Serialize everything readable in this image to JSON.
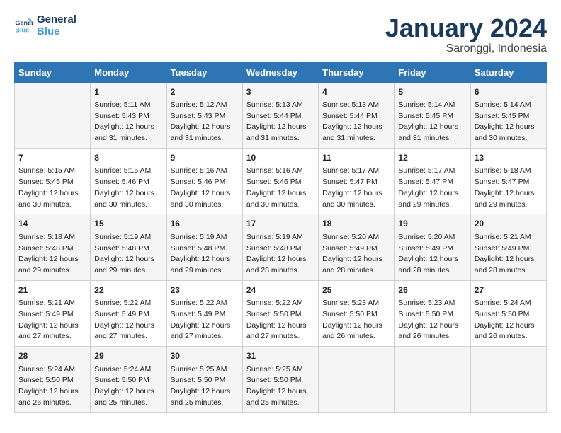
{
  "header": {
    "logo_general": "General",
    "logo_blue": "Blue",
    "title": "January 2024",
    "subtitle": "Saronggi, Indonesia"
  },
  "days_header": [
    "Sunday",
    "Monday",
    "Tuesday",
    "Wednesday",
    "Thursday",
    "Friday",
    "Saturday"
  ],
  "weeks": [
    [
      {
        "day": "",
        "info": ""
      },
      {
        "day": "1",
        "info": "Sunrise: 5:11 AM\nSunset: 5:43 PM\nDaylight: 12 hours\nand 31 minutes."
      },
      {
        "day": "2",
        "info": "Sunrise: 5:12 AM\nSunset: 5:43 PM\nDaylight: 12 hours\nand 31 minutes."
      },
      {
        "day": "3",
        "info": "Sunrise: 5:13 AM\nSunset: 5:44 PM\nDaylight: 12 hours\nand 31 minutes."
      },
      {
        "day": "4",
        "info": "Sunrise: 5:13 AM\nSunset: 5:44 PM\nDaylight: 12 hours\nand 31 minutes."
      },
      {
        "day": "5",
        "info": "Sunrise: 5:14 AM\nSunset: 5:45 PM\nDaylight: 12 hours\nand 31 minutes."
      },
      {
        "day": "6",
        "info": "Sunrise: 5:14 AM\nSunset: 5:45 PM\nDaylight: 12 hours\nand 30 minutes."
      }
    ],
    [
      {
        "day": "7",
        "info": "Sunrise: 5:15 AM\nSunset: 5:45 PM\nDaylight: 12 hours\nand 30 minutes."
      },
      {
        "day": "8",
        "info": "Sunrise: 5:15 AM\nSunset: 5:46 PM\nDaylight: 12 hours\nand 30 minutes."
      },
      {
        "day": "9",
        "info": "Sunrise: 5:16 AM\nSunset: 5:46 PM\nDaylight: 12 hours\nand 30 minutes."
      },
      {
        "day": "10",
        "info": "Sunrise: 5:16 AM\nSunset: 5:46 PM\nDaylight: 12 hours\nand 30 minutes."
      },
      {
        "day": "11",
        "info": "Sunrise: 5:17 AM\nSunset: 5:47 PM\nDaylight: 12 hours\nand 30 minutes."
      },
      {
        "day": "12",
        "info": "Sunrise: 5:17 AM\nSunset: 5:47 PM\nDaylight: 12 hours\nand 29 minutes."
      },
      {
        "day": "13",
        "info": "Sunrise: 5:18 AM\nSunset: 5:47 PM\nDaylight: 12 hours\nand 29 minutes."
      }
    ],
    [
      {
        "day": "14",
        "info": "Sunrise: 5:18 AM\nSunset: 5:48 PM\nDaylight: 12 hours\nand 29 minutes."
      },
      {
        "day": "15",
        "info": "Sunrise: 5:19 AM\nSunset: 5:48 PM\nDaylight: 12 hours\nand 29 minutes."
      },
      {
        "day": "16",
        "info": "Sunrise: 5:19 AM\nSunset: 5:48 PM\nDaylight: 12 hours\nand 29 minutes."
      },
      {
        "day": "17",
        "info": "Sunrise: 5:19 AM\nSunset: 5:48 PM\nDaylight: 12 hours\nand 28 minutes."
      },
      {
        "day": "18",
        "info": "Sunrise: 5:20 AM\nSunset: 5:49 PM\nDaylight: 12 hours\nand 28 minutes."
      },
      {
        "day": "19",
        "info": "Sunrise: 5:20 AM\nSunset: 5:49 PM\nDaylight: 12 hours\nand 28 minutes."
      },
      {
        "day": "20",
        "info": "Sunrise: 5:21 AM\nSunset: 5:49 PM\nDaylight: 12 hours\nand 28 minutes."
      }
    ],
    [
      {
        "day": "21",
        "info": "Sunrise: 5:21 AM\nSunset: 5:49 PM\nDaylight: 12 hours\nand 27 minutes."
      },
      {
        "day": "22",
        "info": "Sunrise: 5:22 AM\nSunset: 5:49 PM\nDaylight: 12 hours\nand 27 minutes."
      },
      {
        "day": "23",
        "info": "Sunrise: 5:22 AM\nSunset: 5:49 PM\nDaylight: 12 hours\nand 27 minutes."
      },
      {
        "day": "24",
        "info": "Sunrise: 5:22 AM\nSunset: 5:50 PM\nDaylight: 12 hours\nand 27 minutes."
      },
      {
        "day": "25",
        "info": "Sunrise: 5:23 AM\nSunset: 5:50 PM\nDaylight: 12 hours\nand 26 minutes."
      },
      {
        "day": "26",
        "info": "Sunrise: 5:23 AM\nSunset: 5:50 PM\nDaylight: 12 hours\nand 26 minutes."
      },
      {
        "day": "27",
        "info": "Sunrise: 5:24 AM\nSunset: 5:50 PM\nDaylight: 12 hours\nand 26 minutes."
      }
    ],
    [
      {
        "day": "28",
        "info": "Sunrise: 5:24 AM\nSunset: 5:50 PM\nDaylight: 12 hours\nand 26 minutes."
      },
      {
        "day": "29",
        "info": "Sunrise: 5:24 AM\nSunset: 5:50 PM\nDaylight: 12 hours\nand 25 minutes."
      },
      {
        "day": "30",
        "info": "Sunrise: 5:25 AM\nSunset: 5:50 PM\nDaylight: 12 hours\nand 25 minutes."
      },
      {
        "day": "31",
        "info": "Sunrise: 5:25 AM\nSunset: 5:50 PM\nDaylight: 12 hours\nand 25 minutes."
      },
      {
        "day": "",
        "info": ""
      },
      {
        "day": "",
        "info": ""
      },
      {
        "day": "",
        "info": ""
      }
    ]
  ]
}
